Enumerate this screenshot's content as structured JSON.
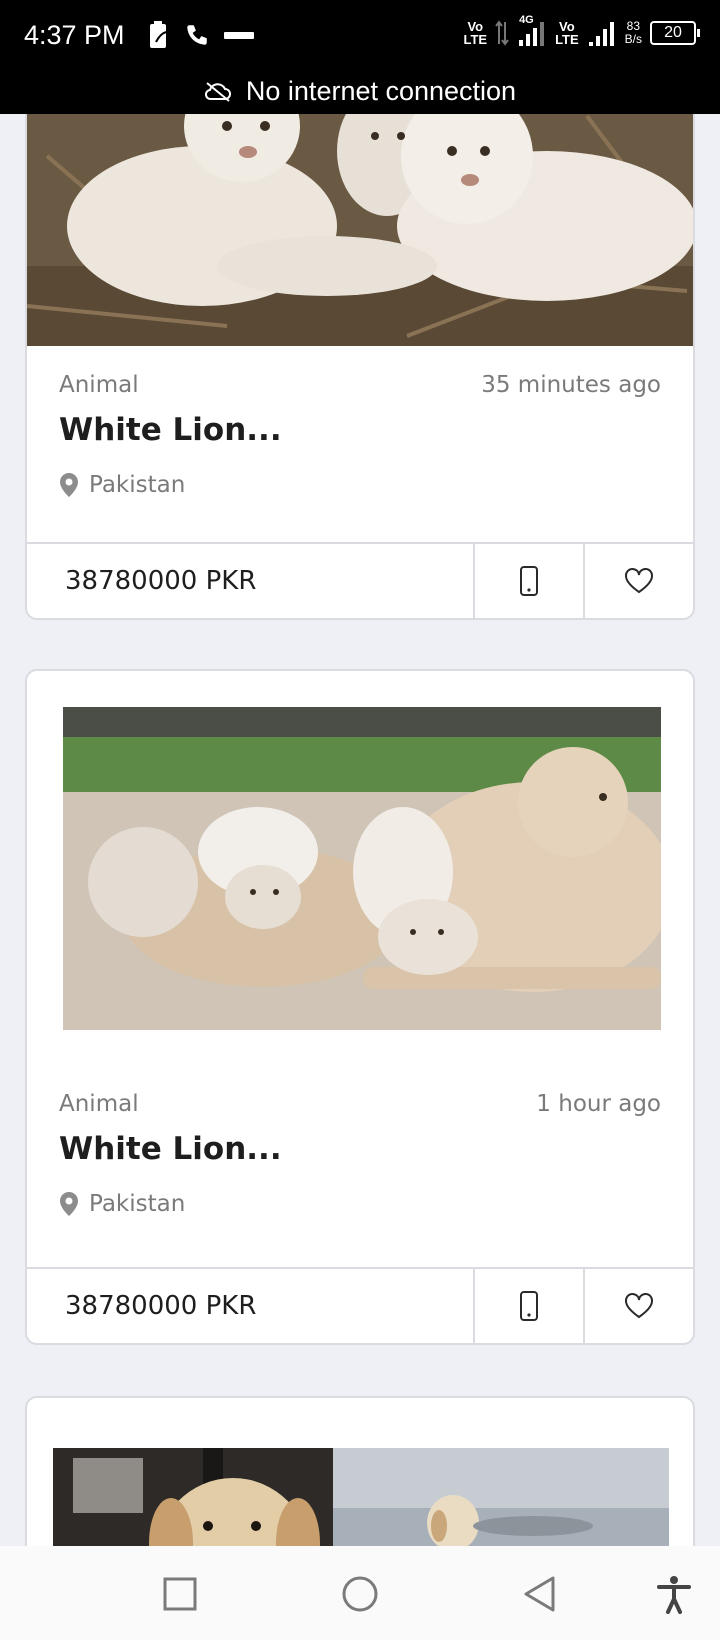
{
  "status_bar": {
    "time": "4:37 PM",
    "lte_1": "Vo\nLTE",
    "signal_4g": "4G",
    "lte_2": "Vo\nLTE",
    "net_speed_value": "83",
    "net_speed_unit": "B/s",
    "battery": "20"
  },
  "offline_banner": {
    "text": "No internet connection"
  },
  "listings": [
    {
      "category": "Animal",
      "time_ago": "35 minutes ago",
      "title": "White Lion...",
      "location": "Pakistan",
      "price": "38780000 PKR"
    },
    {
      "category": "Animal",
      "time_ago": "1 hour ago",
      "title": "White Lion...",
      "location": "Pakistan",
      "price": "38780000 PKR"
    }
  ],
  "icons": {
    "phone": "phone-icon",
    "favorite": "heart-icon",
    "location": "location-pin-icon",
    "nav_recents": "square-icon",
    "nav_home": "circle-icon",
    "nav_back": "triangle-back-icon",
    "accessibility": "accessibility-icon"
  },
  "colors": {
    "status_bar": "#000000",
    "background": "#eef0f5",
    "card": "#ffffff",
    "muted_text": "#7a7a7a"
  }
}
